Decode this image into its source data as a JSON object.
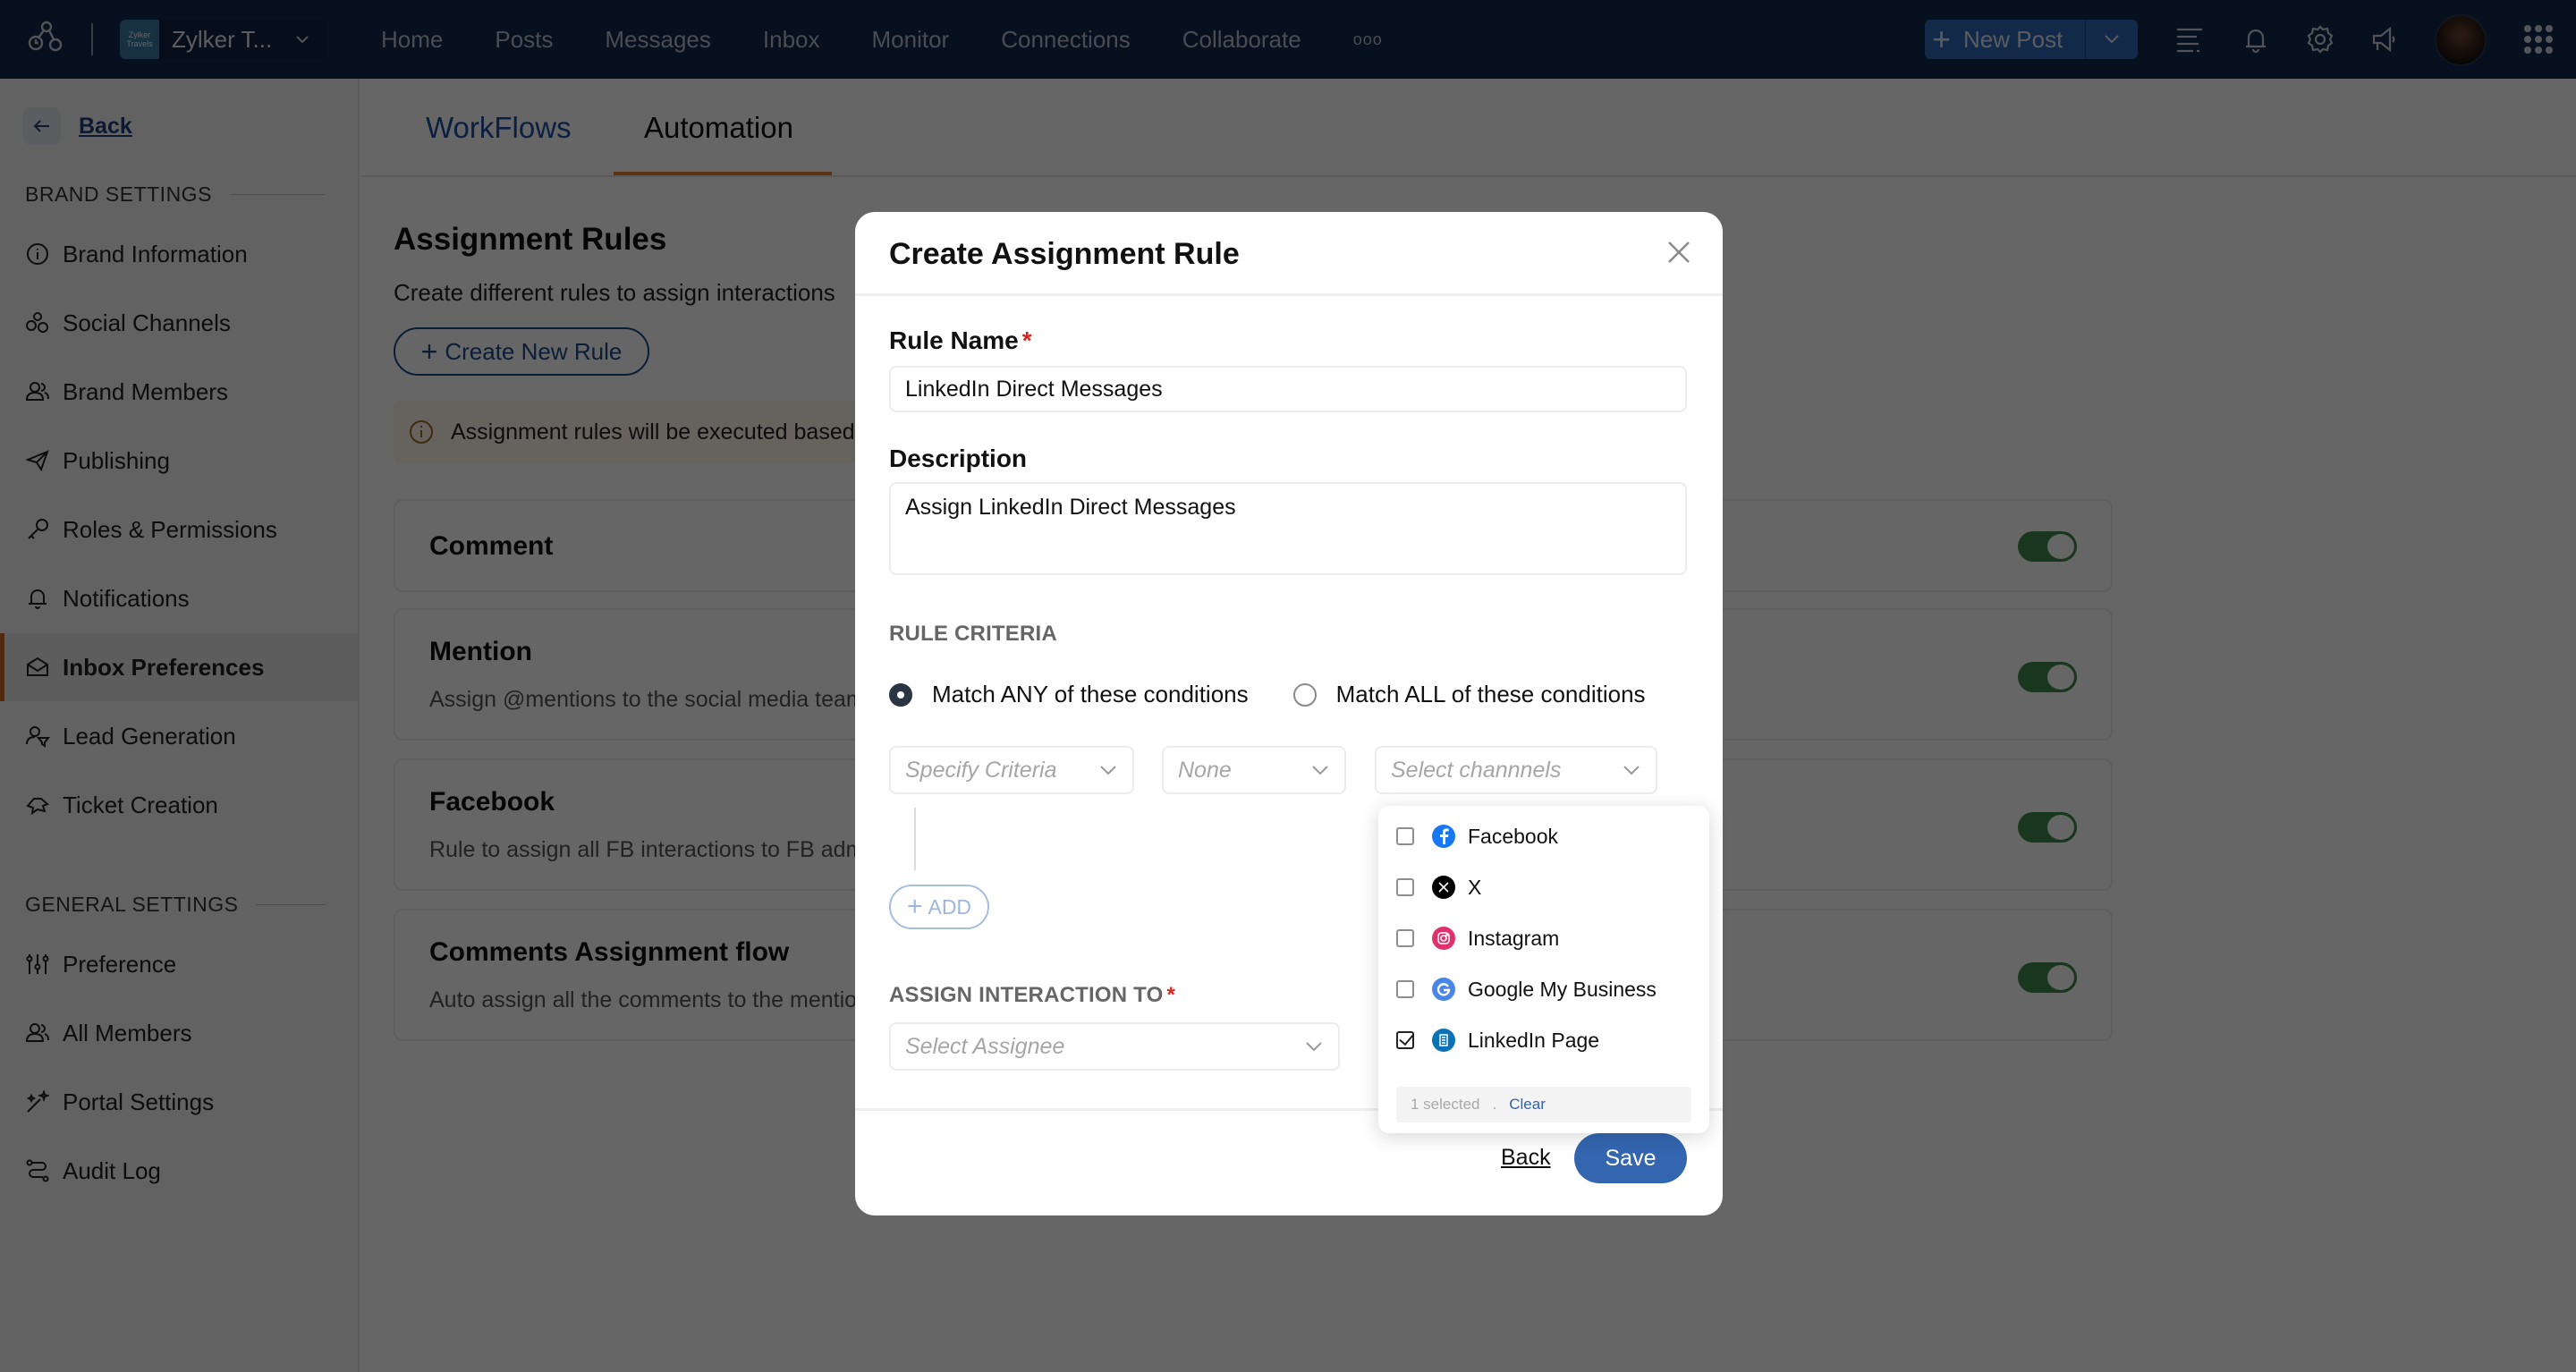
{
  "topnav": {
    "brand_name": "Zylker T...",
    "brand_logo_text": [
      "Zylker",
      "Travels"
    ],
    "links": [
      "Home",
      "Posts",
      "Messages",
      "Inbox",
      "Monitor",
      "Connections",
      "Collaborate"
    ],
    "more_label": "ooo",
    "new_post_label": "New Post",
    "icons": [
      "menu-lines-icon",
      "bell-icon",
      "gear-icon",
      "megaphone-icon"
    ]
  },
  "sidebar": {
    "back_label": "Back",
    "brand_settings_label": "BRAND SETTINGS",
    "brand_items": [
      {
        "label": "Brand Information",
        "icon": "info-icon"
      },
      {
        "label": "Social Channels",
        "icon": "channels-icon"
      },
      {
        "label": "Brand Members",
        "icon": "members-icon"
      },
      {
        "label": "Publishing",
        "icon": "send-icon"
      },
      {
        "label": "Roles & Permissions",
        "icon": "key-icon"
      },
      {
        "label": "Notifications",
        "icon": "bell-icon"
      },
      {
        "label": "Inbox Preferences",
        "icon": "inbox-icon",
        "active": true
      },
      {
        "label": "Lead Generation",
        "icon": "lead-icon"
      },
      {
        "label": "Ticket Creation",
        "icon": "ticket-icon"
      }
    ],
    "general_settings_label": "GENERAL SETTINGS",
    "general_items": [
      {
        "label": "Preference",
        "icon": "sliders-icon"
      },
      {
        "label": "All Members",
        "icon": "members-icon"
      },
      {
        "label": "Portal Settings",
        "icon": "magic-wand-icon"
      },
      {
        "label": "Audit Log",
        "icon": "route-icon"
      }
    ]
  },
  "main": {
    "tabs": [
      {
        "label": "WorkFlows",
        "active": false
      },
      {
        "label": "Automation",
        "active": true
      }
    ],
    "title": "Assignment Rules",
    "subtitle": "Create different rules to assign interactions",
    "create_button": "Create New Rule",
    "info_banner": "Assignment rules will be executed based",
    "rules": [
      {
        "title": "Comment",
        "description": "",
        "enabled": true
      },
      {
        "title": "Mention",
        "description": "Assign @mentions to the social media team",
        "enabled": true
      },
      {
        "title": "Facebook",
        "description": "Rule to assign all FB interactions to FB admi",
        "enabled": true
      },
      {
        "title": "Comments Assignment flow",
        "description": "Auto assign all the comments to the mentio",
        "enabled": true
      }
    ]
  },
  "modal": {
    "title": "Create Assignment Rule",
    "rule_name_label": "Rule Name",
    "rule_name_value": "LinkedIn Direct Messages",
    "description_label": "Description",
    "description_value": "Assign LinkedIn Direct Messages",
    "criteria_label": "RULE CRITERIA",
    "match_any_label": "Match ANY of these conditions",
    "match_all_label": "Match ALL of these conditions",
    "match_selected": "any",
    "criteria_placeholder": "Specify Criteria",
    "operator_placeholder": "None",
    "channels_placeholder": "Select channnels",
    "add_label": "ADD",
    "assign_label": "ASSIGN INTERACTION TO",
    "assignee_placeholder": "Select Assignee",
    "back_label": "Back",
    "save_label": "Save",
    "required_mark": "*"
  },
  "channels_dropdown": {
    "options": [
      {
        "label": "Facebook",
        "icon": "facebook-icon",
        "checked": false,
        "color": "#1877f2"
      },
      {
        "label": "X",
        "icon": "x-icon",
        "checked": false,
        "color": "#000000"
      },
      {
        "label": "Instagram",
        "icon": "instagram-icon",
        "checked": false,
        "color": "#e1306c"
      },
      {
        "label": "Google My Business",
        "icon": "google-icon",
        "checked": false,
        "color": "#4285f4"
      },
      {
        "label": "LinkedIn Page",
        "icon": "linkedin-page-icon",
        "checked": true,
        "color": "#0a66c2"
      }
    ],
    "selected_count": "1 selected",
    "separator": ".",
    "clear_label": "Clear"
  }
}
